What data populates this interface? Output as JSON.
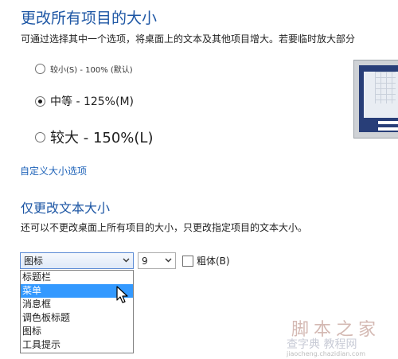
{
  "section1": {
    "title": "更改所有项目的大小",
    "description": "可通过选择其中一个选项，将桌面上的文本及其他项目增大。若要临时放大部分"
  },
  "size_options": [
    {
      "label": "较小(S) - 100% (默认)",
      "checked": false
    },
    {
      "label": "中等 - 125%(M)",
      "checked": true
    },
    {
      "label": "较大 - 150%(L)",
      "checked": false
    }
  ],
  "custom_link": "自定义大小选项",
  "section2": {
    "title": "仅更改文本大小",
    "description": "还可以不更改桌面上所有项目的大小，只更改指定项目的文本大小。"
  },
  "item_select": {
    "value": "图标"
  },
  "size_select": {
    "value": "9"
  },
  "bold_checkbox": {
    "label": "粗体(B)",
    "checked": false
  },
  "dropdown": {
    "items": [
      "标题栏",
      "菜单",
      "消息框",
      "调色板标题",
      "图标",
      "工具提示"
    ],
    "selected_index": 1
  },
  "watermark": {
    "line1": "脚本之家",
    "line2": "查字典 教程网",
    "line3": "jiaocheng.chazidian.com"
  },
  "colors": {
    "heading": "#1d56a4",
    "link": "#1d62b8",
    "selection": "#3399ff"
  }
}
